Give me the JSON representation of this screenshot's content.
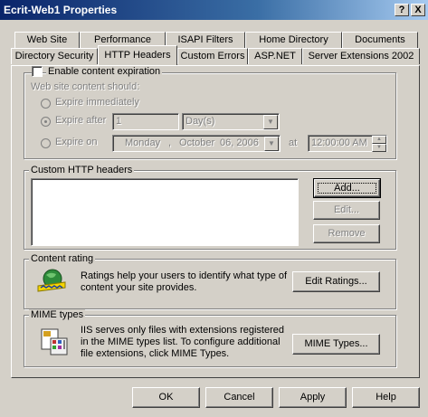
{
  "window": {
    "title": "Ecrit-Web1 Properties",
    "help_label": "?",
    "close_label": "X"
  },
  "tabs_back": [
    "Web Site",
    "Performance",
    "ISAPI Filters",
    "Home Directory",
    "Documents"
  ],
  "tabs_front": [
    "Directory Security",
    "HTTP Headers",
    "Custom Errors",
    "ASP.NET",
    "Server Extensions 2002"
  ],
  "active_tab": "HTTP Headers",
  "expiration": {
    "checkbox_label": "Enable content expiration",
    "checked": false,
    "subtitle": "Web site content should:",
    "radio_immediately": "Expire immediately",
    "radio_after": "Expire after",
    "radio_on": "Expire on",
    "after_value": "1",
    "after_unit": "Day(s)",
    "date_weekday": "Monday",
    "date_sep": ",",
    "date_month": "October",
    "date_day": "06, 2006",
    "at_label": "at",
    "time_value": "12:00:00 AM"
  },
  "custom_headers": {
    "label": "Custom HTTP headers",
    "items": [],
    "add_label": "Add...",
    "edit_label": "Edit...",
    "remove_label": "Remove"
  },
  "content_rating": {
    "label": "Content rating",
    "text": "Ratings help your users to identify what type of content your site provides.",
    "button": "Edit Ratings..."
  },
  "mime": {
    "label": "MIME types",
    "text": "IIS serves only files with extensions registered in the MIME types list. To configure additional file extensions, click MIME Types.",
    "button": "MIME Types..."
  },
  "footer": {
    "ok": "OK",
    "cancel": "Cancel",
    "apply": "Apply",
    "help": "Help"
  },
  "icons": {
    "ratings": "ratings-icon",
    "mime": "mime-types-icon",
    "spin_up": "spin-up-icon",
    "spin_down": "spin-down-icon",
    "dropdown": "chevron-down-icon"
  }
}
